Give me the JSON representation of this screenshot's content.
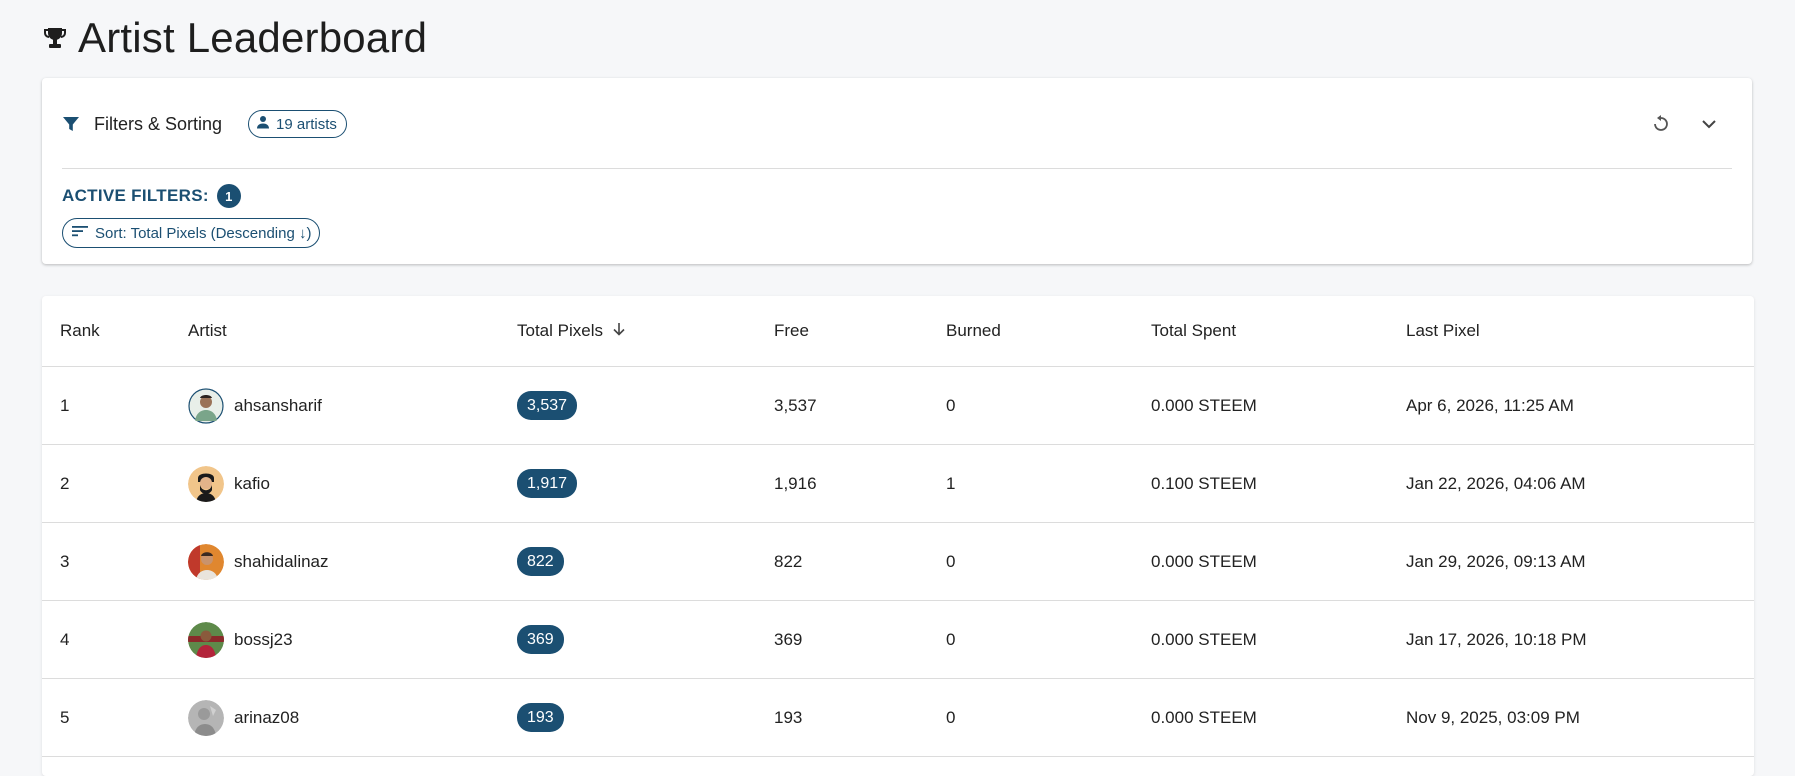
{
  "header": {
    "title": "Artist Leaderboard",
    "icon": "trophy-icon"
  },
  "filters": {
    "title": "Filters & Sorting",
    "artist_count": "19 artists",
    "active_label": "ACTIVE FILTERS:",
    "active_count": "1",
    "sort_chip": "Sort: Total Pixels (Descending ↓)"
  },
  "colors": {
    "accent": "#1b4f72",
    "background": "#f6f7f9"
  },
  "table": {
    "headers": {
      "rank": "Rank",
      "artist": "Artist",
      "total": "Total Pixels",
      "free": "Free",
      "burned": "Burned",
      "spent": "Total Spent",
      "last": "Last Pixel"
    },
    "rows": [
      {
        "rank": "1",
        "artist": "ahsansharif",
        "total": "3,537",
        "free": "3,537",
        "burned": "0",
        "spent": "0.000 STEEM",
        "last": "Apr 6, 2026, 11:25 AM"
      },
      {
        "rank": "2",
        "artist": "kafio",
        "total": "1,917",
        "free": "1,916",
        "burned": "1",
        "spent": "0.100 STEEM",
        "last": "Jan 22, 2026, 04:06 AM"
      },
      {
        "rank": "3",
        "artist": "shahidalinaz",
        "total": "822",
        "free": "822",
        "burned": "0",
        "spent": "0.000 STEEM",
        "last": "Jan 29, 2026, 09:13 AM"
      },
      {
        "rank": "4",
        "artist": "bossj23",
        "total": "369",
        "free": "369",
        "burned": "0",
        "spent": "0.000 STEEM",
        "last": "Jan 17, 2026, 10:18 PM"
      },
      {
        "rank": "5",
        "artist": "arinaz08",
        "total": "193",
        "free": "193",
        "burned": "0",
        "spent": "0.000 STEEM",
        "last": "Nov 9, 2025, 03:09 PM"
      }
    ]
  }
}
